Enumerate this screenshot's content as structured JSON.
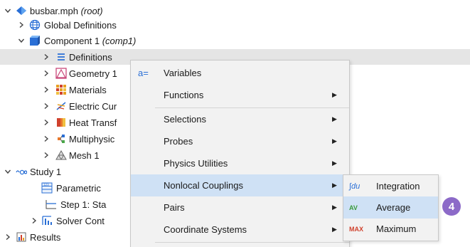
{
  "tree": {
    "root": {
      "label": "busbar.mph",
      "suffix": "(root)"
    },
    "global_definitions": {
      "label": "Global Definitions"
    },
    "component": {
      "label": "Component 1",
      "suffix": "(comp1)"
    },
    "definitions": {
      "label": "Definitions"
    },
    "geometry": {
      "label": "Geometry 1"
    },
    "materials": {
      "label": "Materials"
    },
    "electric_currents": {
      "label": "Electric Cur"
    },
    "heat_transfer": {
      "label": "Heat Transf"
    },
    "multiphysics": {
      "label": "Multiphysic"
    },
    "mesh": {
      "label": "Mesh 1"
    },
    "study": {
      "label": "Study 1"
    },
    "parametric": {
      "label": "Parametric"
    },
    "step1": {
      "label": "Step 1: Sta"
    },
    "solver": {
      "label": "Solver Cont"
    },
    "results": {
      "label": "Results"
    }
  },
  "context_menu": {
    "items": [
      {
        "label": "Variables",
        "icon": "a="
      },
      {
        "label": "Functions"
      },
      {
        "label": "Selections"
      },
      {
        "label": "Probes"
      },
      {
        "label": "Physics Utilities"
      },
      {
        "label": "Nonlocal Couplings"
      },
      {
        "label": "Pairs"
      },
      {
        "label": "Coordinate Systems"
      }
    ]
  },
  "submenu": {
    "items": [
      {
        "label": "Integration",
        "icon": "∫du"
      },
      {
        "label": "Average",
        "icon": "AV"
      },
      {
        "label": "Maximum",
        "icon": "MAX"
      }
    ]
  },
  "step_badge": "4",
  "colors": {
    "menu_bg": "#f2f2f2",
    "hover": "#cfe1f5",
    "badge": "#8c6ac8",
    "selected_row": "#e5e5e5"
  }
}
